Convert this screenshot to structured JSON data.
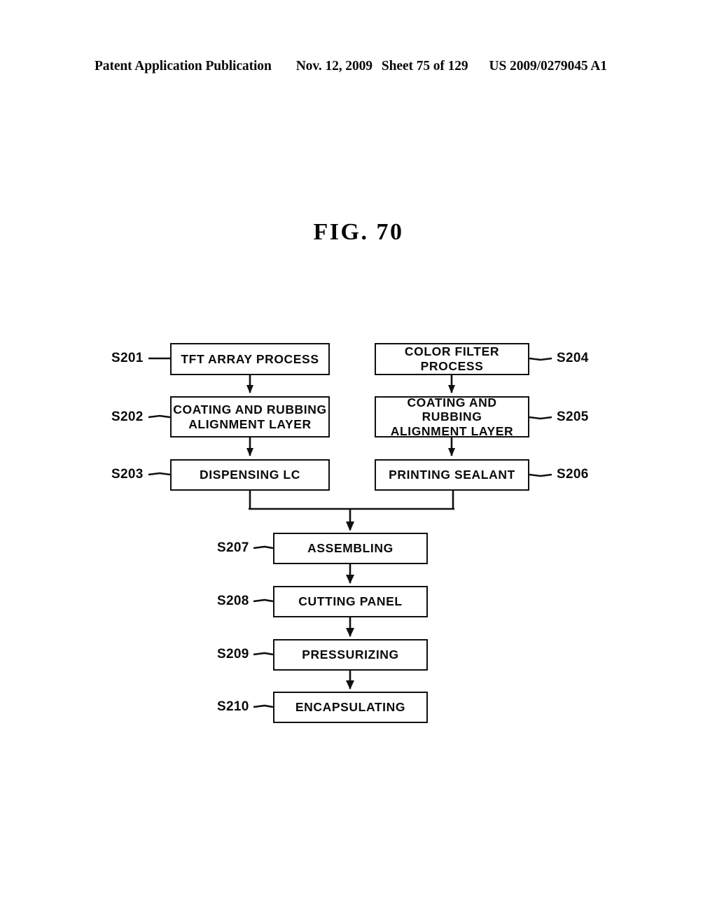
{
  "header": {
    "publication": "Patent Application Publication",
    "date": "Nov. 12, 2009",
    "sheet": "Sheet 75 of 129",
    "patent_number": "US 2009/0279045 A1"
  },
  "figure": {
    "title": "FIG. 70",
    "ink_color": "#0b0b0b",
    "background_color": "#ffffff"
  },
  "flowchart": {
    "left_branch": [
      {
        "id": "S201",
        "label": "TFT ARRAY PROCESS",
        "line1": "TFT ARRAY PROCESS",
        "line2": ""
      },
      {
        "id": "S202",
        "label": "COATING AND RUBBING ALIGNMENT LAYER",
        "line1": "COATING AND RUBBING",
        "line2": "ALIGNMENT LAYER"
      },
      {
        "id": "S203",
        "label": "DISPENSING LC",
        "line1": "DISPENSING LC",
        "line2": ""
      }
    ],
    "right_branch": [
      {
        "id": "S204",
        "label": "COLOR FILTER PROCESS",
        "line1": "COLOR FILTER PROCESS",
        "line2": ""
      },
      {
        "id": "S205",
        "label": "COATING AND RUBBING ALIGNMENT LAYER",
        "line1": "COATING AND RUBBING",
        "line2": "ALIGNMENT LAYER"
      },
      {
        "id": "S206",
        "label": "PRINTING SEALANT",
        "line1": "PRINTING SEALANT",
        "line2": ""
      }
    ],
    "merged_chain": [
      {
        "id": "S207",
        "label": "ASSEMBLING"
      },
      {
        "id": "S208",
        "label": "CUTTING PANEL"
      },
      {
        "id": "S209",
        "label": "PRESSURIZING"
      },
      {
        "id": "S210",
        "label": "ENCAPSULATING"
      }
    ]
  }
}
